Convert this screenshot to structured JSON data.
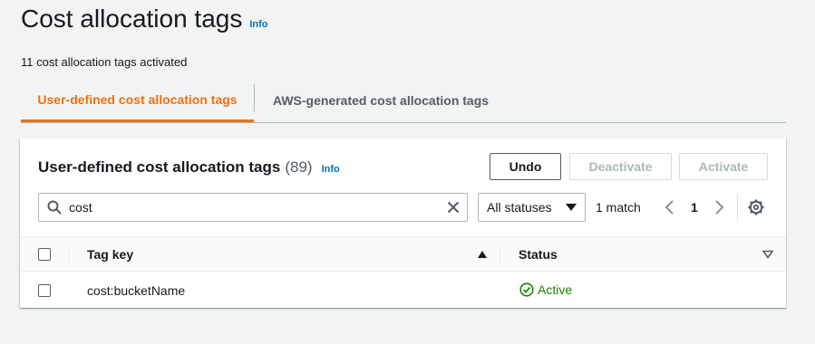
{
  "page": {
    "title": "Cost allocation tags",
    "info": "Info",
    "subtitle": "11 cost allocation tags activated"
  },
  "tabs": [
    {
      "label": "User-defined cost allocation tags",
      "active": true
    },
    {
      "label": "AWS-generated cost allocation tags",
      "active": false
    }
  ],
  "panel": {
    "title": "User-defined cost allocation tags",
    "count": "(89)",
    "info": "Info",
    "buttons": {
      "undo": "Undo",
      "deactivate": "Deactivate",
      "activate": "Activate"
    },
    "search": {
      "value": "cost",
      "icon": "search-icon",
      "clear_icon": "close-icon"
    },
    "status_filter": {
      "selected": "All statuses"
    },
    "match_text": "1 match",
    "pagination": {
      "current_page": "1"
    },
    "settings_icon": "gear-icon"
  },
  "table": {
    "columns": [
      "Tag key",
      "Status"
    ],
    "rows": [
      {
        "tag_key": "cost:bucketName",
        "status": "Active"
      }
    ]
  },
  "colors": {
    "accent": "#ec7211",
    "link": "#0073bb",
    "success": "#1d8102"
  }
}
